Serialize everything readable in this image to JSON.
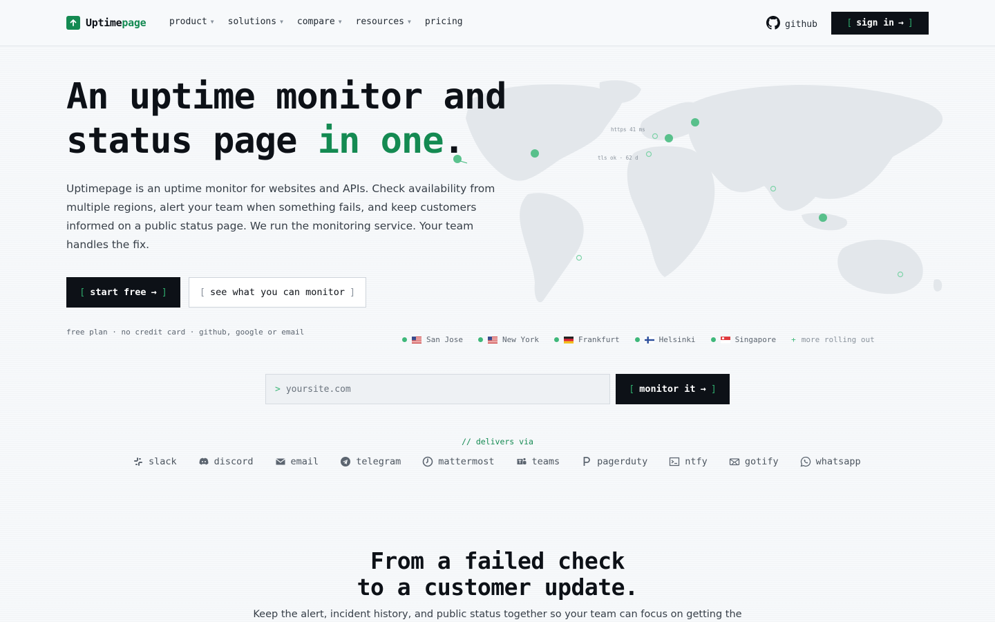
{
  "header": {
    "logo_prefix": "Uptime",
    "logo_suffix": "page",
    "nav": [
      {
        "label": "product",
        "has_caret": true
      },
      {
        "label": "solutions",
        "has_caret": true
      },
      {
        "label": "compare",
        "has_caret": true
      },
      {
        "label": "resources",
        "has_caret": true
      },
      {
        "label": "pricing",
        "has_caret": false
      }
    ],
    "github_label": "github",
    "signin_label": "sign in"
  },
  "hero": {
    "title_line1": "An uptime monitor and",
    "title_line2_start": "status page ",
    "title_line2_accent": "in one",
    "title_line2_end": ".",
    "description": "Uptimepage is an uptime monitor for websites and APIs. Check availability from multiple regions, alert your team when something fails, and keep customers informed on a public status page. We run the monitoring service. Your team handles the fix.",
    "cta_primary": "start free",
    "cta_secondary": "see what you can monitor",
    "fineprint": "free plan · no credit card · github, google or email"
  },
  "map": {
    "annotation_1": "https 41 ms",
    "annotation_2": "tls ok · 62 d"
  },
  "regions": [
    {
      "name": "San Jose",
      "flag": "us"
    },
    {
      "name": "New York",
      "flag": "us"
    },
    {
      "name": "Frankfurt",
      "flag": "de"
    },
    {
      "name": "Helsinki",
      "flag": "fi"
    },
    {
      "name": "Singapore",
      "flag": "sg"
    }
  ],
  "regions_more": "more rolling out",
  "monitor_form": {
    "prompt": ">",
    "placeholder": "yoursite.com",
    "button_label": "monitor it"
  },
  "delivers_label": "// delivers via",
  "integrations": [
    {
      "label": "slack",
      "icon": "slack-icon"
    },
    {
      "label": "discord",
      "icon": "discord-icon"
    },
    {
      "label": "email",
      "icon": "email-icon"
    },
    {
      "label": "telegram",
      "icon": "telegram-icon"
    },
    {
      "label": "mattermost",
      "icon": "mattermost-icon"
    },
    {
      "label": "teams",
      "icon": "teams-icon"
    },
    {
      "label": "pagerduty",
      "icon": "pagerduty-icon"
    },
    {
      "label": "ntfy",
      "icon": "ntfy-icon"
    },
    {
      "label": "gotify",
      "icon": "gotify-icon"
    },
    {
      "label": "whatsapp",
      "icon": "whatsapp-icon"
    }
  ],
  "section2": {
    "title_line1": "From a failed check",
    "title_line2": "to a customer update.",
    "description": "Keep the alert, incident history, and public status together so your team can focus on getting the"
  },
  "colors": {
    "accent": "#148a52",
    "dark": "#0d1117",
    "status_dot": "#3fb87a",
    "background": "#f7f9fb"
  }
}
